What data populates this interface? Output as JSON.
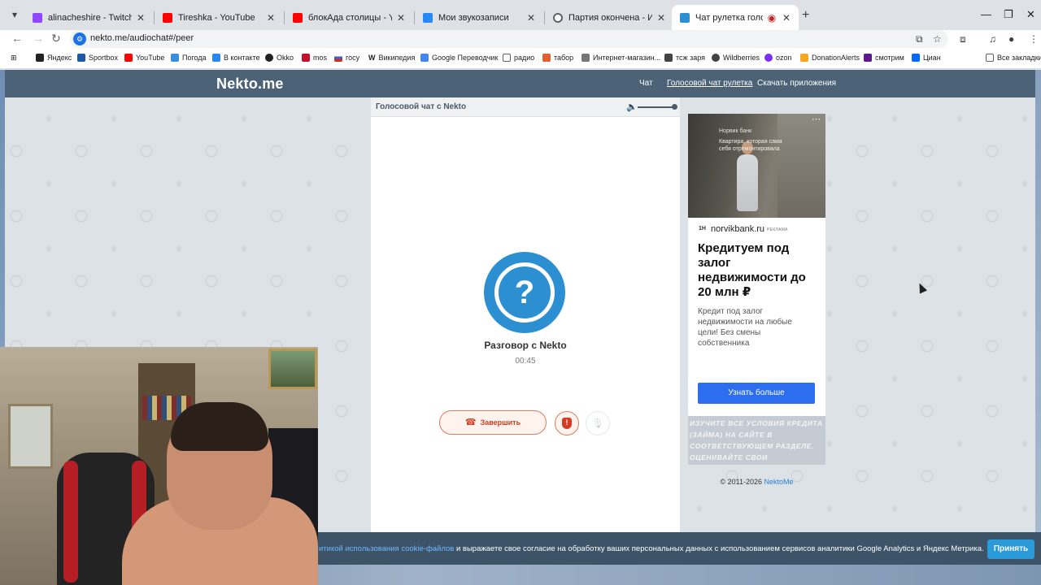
{
  "browser": {
    "tabs": [
      {
        "title": "alinacheshire - Twitch",
        "color": "#9146ff"
      },
      {
        "title": "Tireshka - YouTube",
        "color": "#ff0000"
      },
      {
        "title": "блокАда столицы - YouTube",
        "color": "#ff0000"
      },
      {
        "title": "Мои звукозаписи",
        "color": "#2787f5"
      },
      {
        "title": "Партия окончена - Игра iguan",
        "color": "#5f6368"
      },
      {
        "title": "Чат рулетка голосовая — Н",
        "color": "#2c8fd1",
        "active": true
      }
    ],
    "url": "nekto.me/audiochat#/peer",
    "bookmarks": [
      {
        "label": "Яндекс",
        "color": "#222"
      },
      {
        "label": "Sportbox",
        "color": "#1c5aa8"
      },
      {
        "label": "YouTube",
        "color": "#ff0000"
      },
      {
        "label": "Погода",
        "color": "#3b8de0"
      },
      {
        "label": "В контакте",
        "color": "#2787f5"
      },
      {
        "label": "Okko",
        "color": "#222"
      },
      {
        "label": "mos",
        "color": "#c8102e"
      },
      {
        "label": "госу",
        "color": "#3366cc"
      },
      {
        "label": "Википедия",
        "color": "#555"
      },
      {
        "label": "Google Переводчик",
        "color": "#4285f4"
      },
      {
        "label": "радио",
        "color": "#666"
      },
      {
        "label": "табор",
        "color": "#e06030"
      },
      {
        "label": "Интернет-магазин...",
        "color": "#777"
      },
      {
        "label": "тсж заря",
        "color": "#444"
      },
      {
        "label": "Wildberries",
        "color": "#444"
      },
      {
        "label": "ozon",
        "color": "#7b2ff7"
      },
      {
        "label": "DonationAlerts",
        "color": "#f5a623"
      },
      {
        "label": "смотрим",
        "color": "#5a1a8a"
      },
      {
        "label": "Циан",
        "color": "#0468ff"
      }
    ],
    "all_bookmarks": "Все закладки"
  },
  "site": {
    "logo": "Nekto.me",
    "nav": [
      "Чат",
      "Голосовой чат рулетка",
      "Скачать приложения"
    ],
    "card_title": "Голосовой чат с Nekto",
    "volume_level": 1.0,
    "peer_name": "Разговор с Nekto",
    "timer": "00:45",
    "end_label": "Завершить",
    "copyright_text": "© 2011-2026",
    "copyright_link": "NektoMe"
  },
  "ad": {
    "brand_top": "Норвик банк",
    "tagline": "Квартира, которая сама себя отремонтировала",
    "domain_icon": "1H",
    "domain": "norvikbank.ru",
    "label": "РЕКЛАМА",
    "headline": "Кредитуем под залог недвижимости до 20 млн ₽",
    "description": "Кредит под залог недвижимости на любые цели! Без смены собственника",
    "button": "Узнать больше",
    "disclaimer": "Изучите все условия кредита (займа) на сайте в соответствующем разделе. Оценивайте свои финансовые возможности и риски"
  },
  "cookie": {
    "link_text": "итикой использования cookie-файлов",
    "text": " и выражаете свое согласие на обработку ваших персональных данных с использованием сервисов аналитики Google Analytics и Яндекс Метрика.",
    "accept": "Принять"
  }
}
